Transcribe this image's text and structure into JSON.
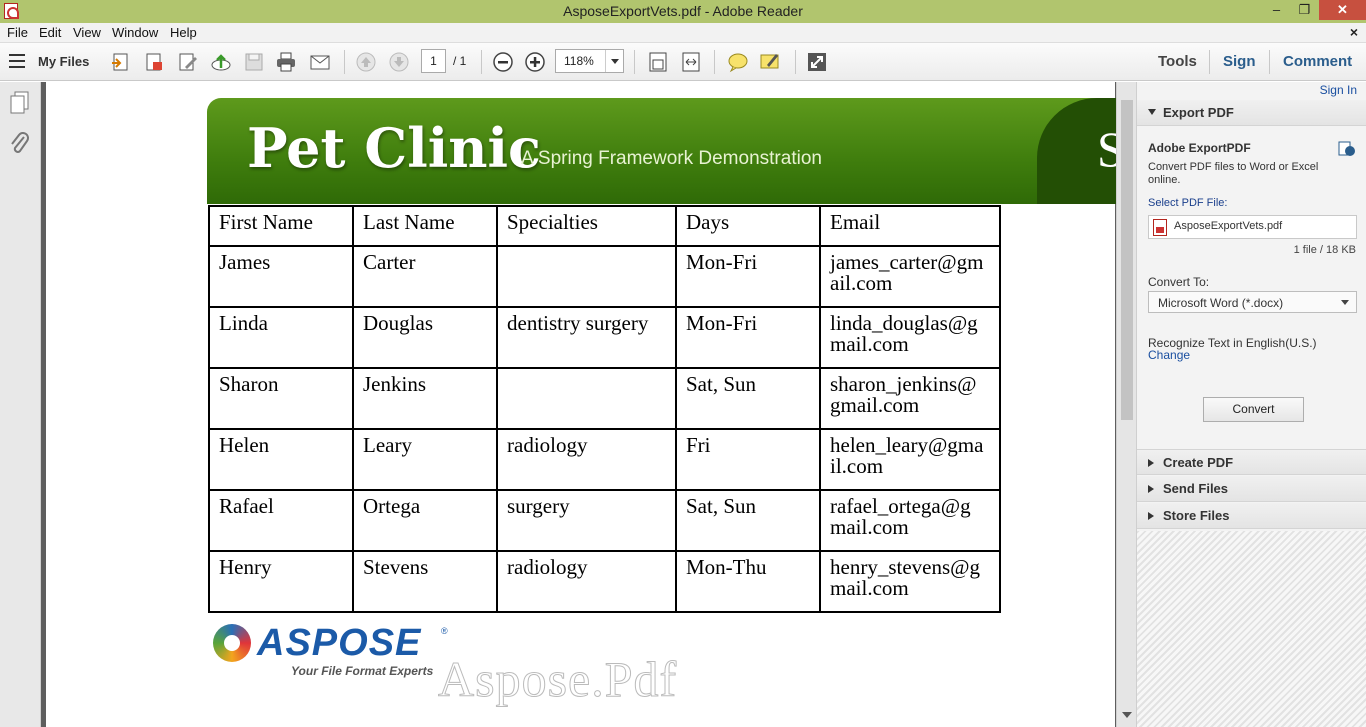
{
  "window": {
    "title": "AsposeExportVets.pdf - Adobe Reader",
    "min": "–",
    "restore": "❐",
    "close": "✕"
  },
  "menu": [
    "File",
    "Edit",
    "View",
    "Window",
    "Help"
  ],
  "toolbar": {
    "my_files": "My Files",
    "page_current": "1",
    "page_total": "/ 1",
    "zoom": "118%",
    "tools": "Tools",
    "sign": "Sign",
    "comment": "Comment"
  },
  "right_panel": {
    "sign_in": "Sign In",
    "export_pdf": "Export PDF",
    "adobe_exportpdf": "Adobe ExportPDF",
    "desc": "Convert PDF files to Word or Excel online.",
    "select_label": "Select PDF File:",
    "file_name": "AsposeExportVets.pdf",
    "file_info": "1 file / 18 KB",
    "convert_to_label": "Convert To:",
    "convert_to_value": "Microsoft Word (*.docx)",
    "recognize": "Recognize Text in English(U.S.)",
    "change": "Change",
    "convert_button": "Convert",
    "create_pdf": "Create PDF",
    "send_files": "Send Files",
    "store_files": "Store Files"
  },
  "document": {
    "banner_title": "Pet Clinic",
    "banner_subtitle": "A Spring Framework Demonstration",
    "banner_cut": "S",
    "table": {
      "headers": [
        "First Name",
        "Last Name",
        "Specialties",
        "Days",
        "Email"
      ],
      "rows": [
        [
          "James",
          "Carter",
          "",
          "Mon-Fri",
          "james_carter@gm ail.com"
        ],
        [
          "Linda",
          "Douglas",
          "dentistry surgery",
          "Mon-Fri",
          "linda_douglas@g mail.com"
        ],
        [
          "Sharon",
          "Jenkins",
          "",
          "Sat, Sun",
          "sharon_jenkins@ gmail.com"
        ],
        [
          "Helen",
          "Leary",
          "radiology",
          "Fri",
          "helen_leary@gma il.com"
        ],
        [
          "Rafael",
          "Ortega",
          "surgery",
          "Sat, Sun",
          "rafael_ortega@g mail.com"
        ],
        [
          "Henry",
          "Stevens",
          "radiology",
          "Mon-Thu",
          "henry_stevens@g mail.com"
        ]
      ]
    },
    "logo_word": "ASPOSE",
    "logo_reg": "®",
    "logo_tagline": "Your File Format Experts",
    "watermark": "Aspose.Pdf"
  }
}
